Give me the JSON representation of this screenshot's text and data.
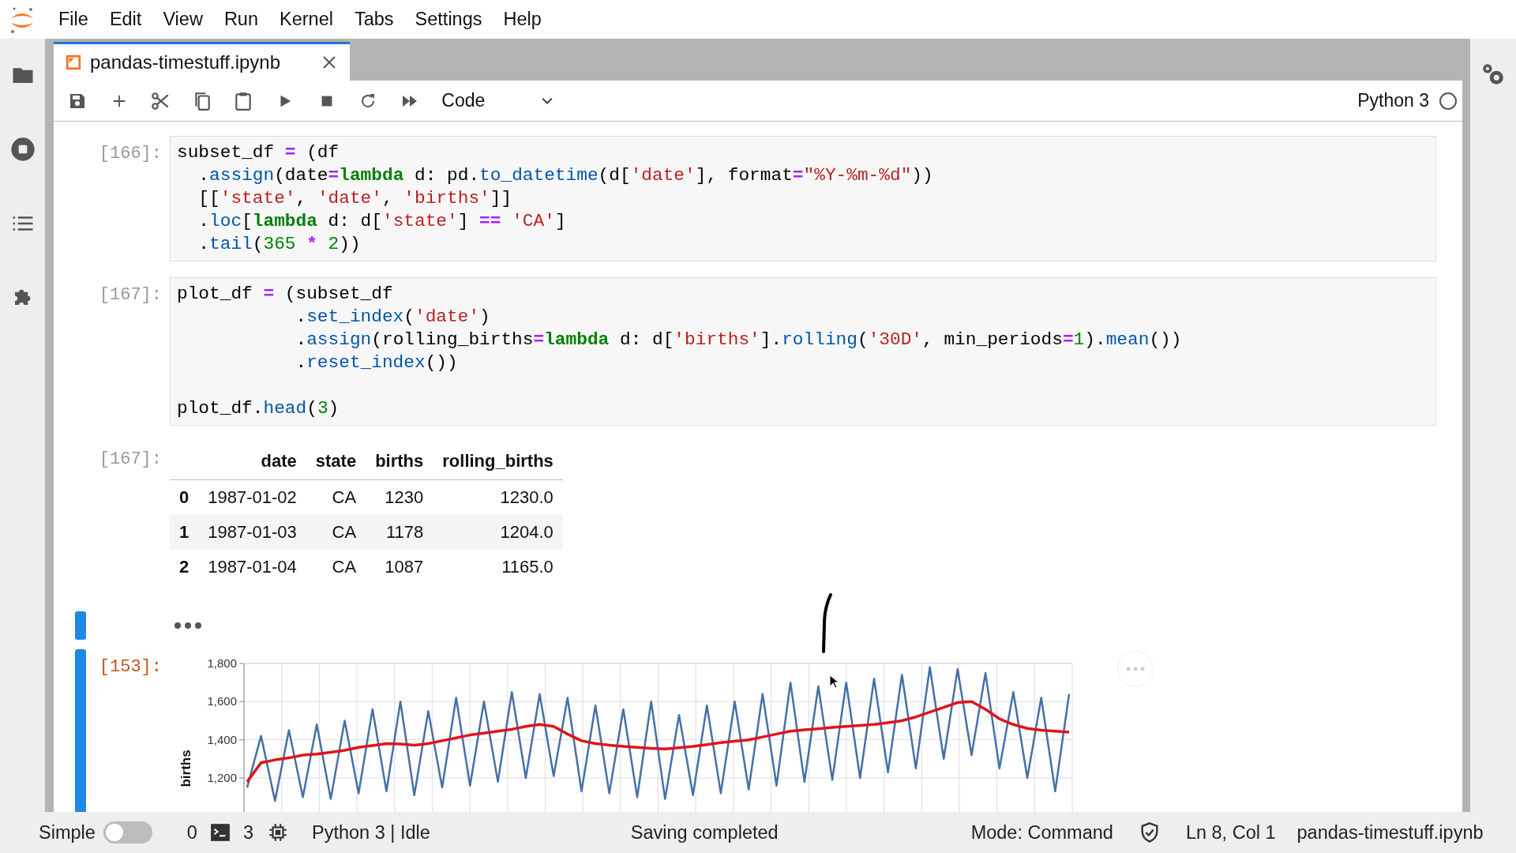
{
  "menu": [
    "File",
    "Edit",
    "View",
    "Run",
    "Kernel",
    "Tabs",
    "Settings",
    "Help"
  ],
  "tab": {
    "title": "pandas-timestuff.ipynb",
    "selected": true
  },
  "toolbar": {
    "cell_type": "Code",
    "kernel": "Python 3",
    "kernel_busy": false
  },
  "cells": [
    {
      "kind": "code",
      "prompt": "[166]:",
      "active": false,
      "blocks": [
        {
          "lines": [
            [
              {
                "kind": "plain",
                "text": "subset_df "
              },
              {
                "kind": "op",
                "text": "="
              },
              {
                "kind": "plain",
                "text": " (df"
              }
            ],
            [
              {
                "kind": "plain",
                "text": "  ."
              },
              {
                "kind": "fn",
                "text": "assign"
              },
              {
                "kind": "plain",
                "text": "(date"
              },
              {
                "kind": "op",
                "text": "="
              },
              {
                "kind": "kw",
                "text": "lambda"
              },
              {
                "kind": "plain",
                "text": " d: pd."
              },
              {
                "kind": "fn",
                "text": "to_datetime"
              },
              {
                "kind": "plain",
                "text": "(d["
              },
              {
                "kind": "str",
                "text": "'date'"
              },
              {
                "kind": "plain",
                "text": "], format"
              },
              {
                "kind": "op",
                "text": "="
              },
              {
                "kind": "str",
                "text": "\"%Y-%m-%d\""
              },
              {
                "kind": "plain",
                "text": "))"
              }
            ],
            [
              {
                "kind": "plain",
                "text": "  [["
              },
              {
                "kind": "str",
                "text": "'state'"
              },
              {
                "kind": "plain",
                "text": ", "
              },
              {
                "kind": "str",
                "text": "'date'"
              },
              {
                "kind": "plain",
                "text": ", "
              },
              {
                "kind": "str",
                "text": "'births'"
              },
              {
                "kind": "plain",
                "text": "]]"
              }
            ],
            [
              {
                "kind": "plain",
                "text": "  ."
              },
              {
                "kind": "fn",
                "text": "loc"
              },
              {
                "kind": "plain",
                "text": "["
              },
              {
                "kind": "kw",
                "text": "lambda"
              },
              {
                "kind": "plain",
                "text": " d: d["
              },
              {
                "kind": "str",
                "text": "'state'"
              },
              {
                "kind": "plain",
                "text": "] "
              },
              {
                "kind": "op",
                "text": "== "
              },
              {
                "kind": "str",
                "text": "'CA'"
              },
              {
                "kind": "plain",
                "text": "]"
              }
            ],
            [
              {
                "kind": "plain",
                "text": "  ."
              },
              {
                "kind": "fn",
                "text": "tail"
              },
              {
                "kind": "plain",
                "text": "("
              },
              {
                "kind": "num",
                "text": "365"
              },
              {
                "kind": "op",
                "text": " * "
              },
              {
                "kind": "num",
                "text": "2"
              },
              {
                "kind": "plain",
                "text": "))"
              }
            ]
          ]
        }
      ]
    },
    {
      "kind": "code",
      "prompt": "[167]:",
      "active": false,
      "blocks": [
        {
          "lines": [
            [
              {
                "kind": "plain",
                "text": "plot_df "
              },
              {
                "kind": "op",
                "text": "="
              },
              {
                "kind": "plain",
                "text": " (subset_df"
              }
            ],
            [
              {
                "kind": "plain",
                "text": "           ."
              },
              {
                "kind": "fn",
                "text": "set_index"
              },
              {
                "kind": "plain",
                "text": "("
              },
              {
                "kind": "str",
                "text": "'date'"
              },
              {
                "kind": "plain",
                "text": ")"
              }
            ],
            [
              {
                "kind": "plain",
                "text": "           ."
              },
              {
                "kind": "fn",
                "text": "assign"
              },
              {
                "kind": "plain",
                "text": "(rolling_births"
              },
              {
                "kind": "op",
                "text": "="
              },
              {
                "kind": "kw",
                "text": "lambda"
              },
              {
                "kind": "plain",
                "text": " d: d["
              },
              {
                "kind": "str",
                "text": "'births'"
              },
              {
                "kind": "plain",
                "text": "]."
              },
              {
                "kind": "fn",
                "text": "rolling"
              },
              {
                "kind": "plain",
                "text": "("
              },
              {
                "kind": "str",
                "text": "'30D'"
              },
              {
                "kind": "plain",
                "text": ", min_periods"
              },
              {
                "kind": "op",
                "text": "="
              },
              {
                "kind": "num",
                "text": "1"
              },
              {
                "kind": "plain",
                "text": ")."
              },
              {
                "kind": "fn",
                "text": "mean"
              },
              {
                "kind": "plain",
                "text": "())"
              }
            ],
            [
              {
                "kind": "plain",
                "text": "           ."
              },
              {
                "kind": "fn",
                "text": "reset_index"
              },
              {
                "kind": "plain",
                "text": "())"
              }
            ]
          ]
        },
        {
          "lines": [
            [
              {
                "kind": "plain",
                "text": "plot_df."
              },
              {
                "kind": "fn",
                "text": "head"
              },
              {
                "kind": "plain",
                "text": "("
              },
              {
                "kind": "num",
                "text": "3"
              },
              {
                "kind": "plain",
                "text": ")"
              }
            ]
          ]
        }
      ]
    },
    {
      "kind": "table",
      "prompt": "[167]:",
      "active": false,
      "columns": [
        "date",
        "state",
        "births",
        "rolling_births"
      ],
      "rows": [
        {
          "index": "0",
          "cells": [
            "1987-01-02",
            "CA",
            "1230",
            "1230.0"
          ]
        },
        {
          "index": "1",
          "cells": [
            "1987-01-03",
            "CA",
            "1178",
            "1204.0"
          ]
        },
        {
          "index": "2",
          "cells": [
            "1987-01-04",
            "CA",
            "1087",
            "1165.0"
          ]
        }
      ]
    },
    {
      "kind": "collapsed",
      "active": true
    },
    {
      "kind": "chart",
      "prompt": "[153]:",
      "active": true,
      "chart_data": {
        "type": "line",
        "ylabel": "births",
        "grid": true,
        "ylim": [
          1000,
          1800
        ],
        "yticks": [
          {
            "value": 1200,
            "label": "1,200"
          },
          {
            "value": 1400,
            "label": "1,400"
          },
          {
            "value": 1600,
            "label": "1,600"
          },
          {
            "value": 1800,
            "label": "1,800"
          }
        ],
        "series": [
          {
            "color": "#4570a8",
            "values": [
              1150,
              1420,
              1080,
              1450,
              1100,
              1480,
              1090,
              1500,
              1120,
              1560,
              1130,
              1600,
              1110,
              1550,
              1150,
              1620,
              1160,
              1600,
              1180,
              1650,
              1200,
              1640,
              1210,
              1620,
              1130,
              1580,
              1120,
              1560,
              1100,
              1600,
              1090,
              1530,
              1110,
              1580,
              1120,
              1600,
              1140,
              1640,
              1160,
              1700,
              1180,
              1680,
              1190,
              1700,
              1200,
              1720,
              1230,
              1740,
              1250,
              1780,
              1300,
              1770,
              1320,
              1750,
              1250,
              1650,
              1200,
              1620,
              1130,
              1640
            ]
          },
          {
            "color": "#e0141e",
            "values": [
              1180,
              1280,
              1295,
              1305,
              1320,
              1325,
              1335,
              1345,
              1360,
              1370,
              1380,
              1378,
              1372,
              1380,
              1395,
              1410,
              1425,
              1435,
              1445,
              1455,
              1470,
              1480,
              1470,
              1430,
              1395,
              1380,
              1372,
              1365,
              1360,
              1355,
              1352,
              1358,
              1365,
              1375,
              1385,
              1392,
              1400,
              1415,
              1430,
              1445,
              1452,
              1458,
              1465,
              1470,
              1475,
              1480,
              1490,
              1500,
              1520,
              1545,
              1570,
              1595,
              1600,
              1560,
              1510,
              1480,
              1460,
              1450,
              1445,
              1440
            ]
          }
        ]
      }
    }
  ],
  "status_bar": {
    "mode_label": "Simple",
    "simple_mode": false,
    "terminals": "0",
    "kernels": "3",
    "kernel_status": "Python 3 | Idle",
    "message": "Saving completed",
    "mode": "Mode: Command",
    "position": "Ln 8, Col 1",
    "file": "pandas-timestuff.ipynb"
  }
}
